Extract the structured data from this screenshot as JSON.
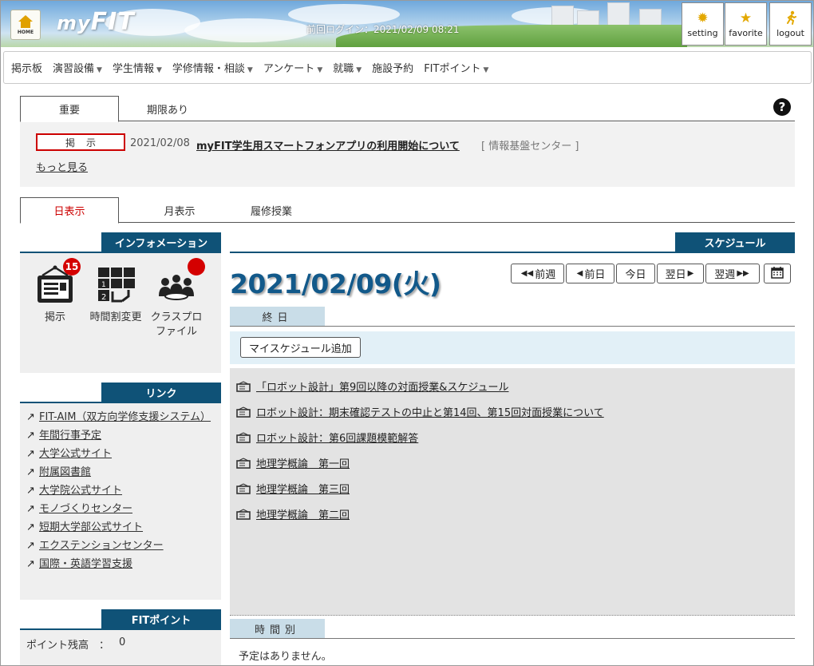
{
  "header": {
    "logo_prefix": "my",
    "logo_main": "FIT",
    "home_label": "HOME",
    "last_login": "前回ログイン：2021/02/09 08:21",
    "buttons": {
      "setting": "setting",
      "favorite": "favorite",
      "logout": "logout"
    }
  },
  "menu": [
    {
      "label": "掲示板",
      "dropdown": false
    },
    {
      "label": "演習設備",
      "dropdown": true
    },
    {
      "label": "学生情報",
      "dropdown": true
    },
    {
      "label": "学修情報・相談",
      "dropdown": true
    },
    {
      "label": "アンケート",
      "dropdown": true
    },
    {
      "label": "就職",
      "dropdown": true
    },
    {
      "label": "施設予約",
      "dropdown": false
    },
    {
      "label": "FITポイント",
      "dropdown": true
    }
  ],
  "notice_tabs": {
    "important": "重要",
    "deadline": "期限あり"
  },
  "notice": {
    "label": "掲示",
    "date": "2021/02/08",
    "title": "myFIT学生用スマートフォンアプリの利用開始について",
    "org": "[ 情報基盤センター ]",
    "more": "もっと見る"
  },
  "view_tabs": {
    "day": "日表示",
    "month": "月表示",
    "courses": "履修授業"
  },
  "info": {
    "heading": "インフォメーション",
    "items": [
      {
        "label": "掲示",
        "badge": "15"
      },
      {
        "label": "時間割変更",
        "badge": ""
      },
      {
        "label": "クラスプロファイル",
        "badge": ""
      }
    ]
  },
  "links": {
    "heading": "リンク",
    "items": [
      "FIT-AIM（双方向学修支援システム）",
      "年間行事予定",
      "大学公式サイト",
      "附属図書館",
      "大学院公式サイト",
      "モノづくりセンター",
      "短期大学部公式サイト",
      "エクステンションセンター",
      "国際・英語学習支援"
    ]
  },
  "points": {
    "heading": "FITポイント",
    "label": "ポイント残高　：",
    "value": "0"
  },
  "schedule": {
    "heading": "スケジュール",
    "date": "2021/02/09(火)",
    "nav": {
      "prev_week": "前週",
      "prev_day": "前日",
      "today": "今日",
      "next_day": "翌日",
      "next_week": "翌週"
    },
    "allday_label": "終日",
    "add_button": "マイスケジュール追加",
    "events": [
      "「ロボット設計」第9回以降の対面授業&スケジュール",
      "ロボット設計：期末確認テストの中止と第14回、第15回対面授業について",
      "ロボット設計：第6回課題模範解答",
      "地理学概論　第一回",
      "地理学概論　第三回",
      "地理学概論　第二回"
    ],
    "timed_label": "時間別",
    "no_events": "予定はありません。"
  }
}
